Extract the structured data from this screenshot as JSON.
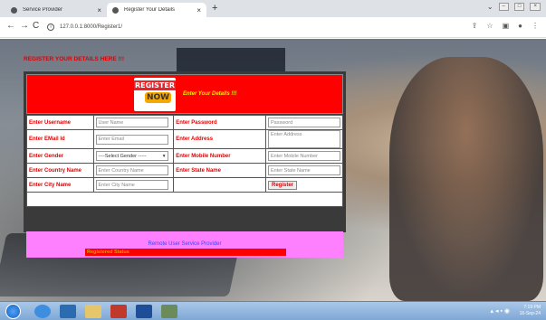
{
  "browser": {
    "tabs": [
      {
        "label": "Service Provider",
        "active": false
      },
      {
        "label": "Register Your Details",
        "active": true
      }
    ],
    "new_tab": "+",
    "url": "127.0.0.1:8000/Register1/",
    "nav": {
      "back": "←",
      "forward": "→",
      "reload": "C"
    }
  },
  "page": {
    "heading": "REGISTER YOUR DETAILS HERE !!!",
    "logo": {
      "line1": "REGISTER",
      "line2": "NOW"
    },
    "banner_text": "Enter Your Details !!!",
    "form": {
      "username_label": "Enter Username",
      "username_placeholder": "User Name",
      "password_label": "Enter Password",
      "password_placeholder": "Password",
      "email_label": "Enter EMail Id",
      "email_placeholder": "Enter Email",
      "address_label": "Enter Address",
      "address_placeholder": "Enter Address",
      "gender_label": "Enter Gender",
      "gender_selected": "----Select Gender -----",
      "mobile_label": "Enter Mobile Number",
      "mobile_placeholder": "Enter Mobile Number",
      "country_label": "Enter Country Name",
      "country_placeholder": "Enter Country Name",
      "state_label": "Enter State Name",
      "state_placeholder": "Enter State Name",
      "city_label": "Enter City Name",
      "city_placeholder": "Enter City Name",
      "register_button": "Register"
    },
    "links": {
      "remote_user": "Remote User",
      "service_provider": "Service Provider"
    },
    "status": "Registered Status"
  },
  "taskbar": {
    "time": "7:19 PM",
    "date": "16-Sep-24"
  },
  "colors": {
    "banner_red": "#ff0000",
    "label_red": "#e00000",
    "pink_bar": "#ff80ff",
    "link_blue": "#4040ff"
  }
}
